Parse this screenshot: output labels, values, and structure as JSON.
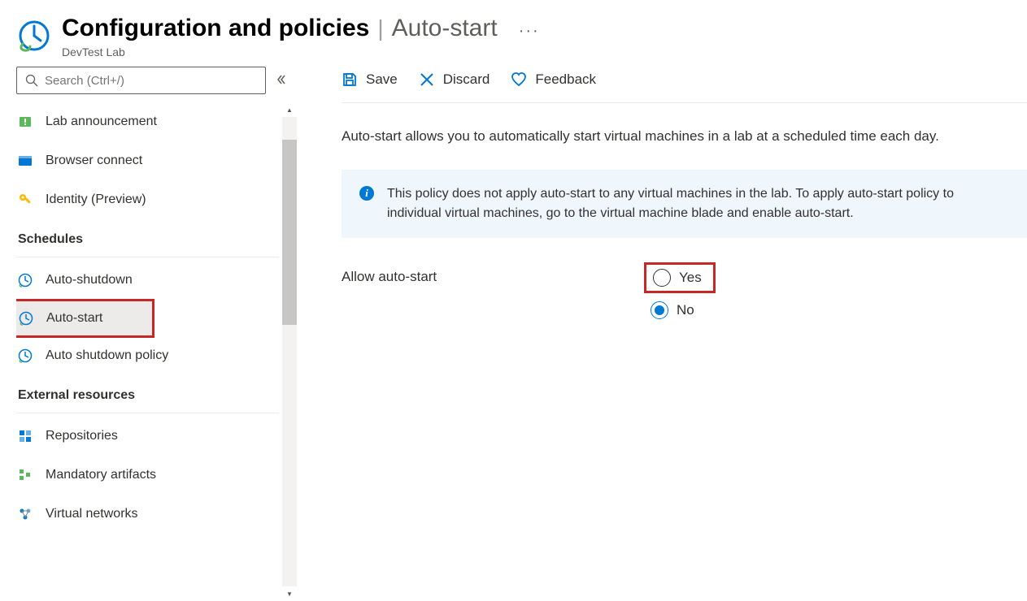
{
  "header": {
    "title": "Configuration and policies",
    "subtitle": "Auto-start",
    "type": "DevTest Lab"
  },
  "search": {
    "placeholder": "Search (Ctrl+/)"
  },
  "sidebar": {
    "items": [
      {
        "label": "Lab announcement"
      },
      {
        "label": "Browser connect"
      },
      {
        "label": "Identity (Preview)"
      }
    ],
    "schedules_header": "Schedules",
    "schedule_items": [
      {
        "label": "Auto-shutdown"
      },
      {
        "label": "Auto-start"
      },
      {
        "label": "Auto shutdown policy"
      }
    ],
    "external_header": "External resources",
    "external_items": [
      {
        "label": "Repositories"
      },
      {
        "label": "Mandatory artifacts"
      },
      {
        "label": "Virtual networks"
      }
    ]
  },
  "toolbar": {
    "save_label": "Save",
    "discard_label": "Discard",
    "feedback_label": "Feedback"
  },
  "main": {
    "description": "Auto-start allows you to automatically start virtual machines in a lab at a scheduled time each day.",
    "info": "This policy does not apply auto-start to any virtual machines in the lab. To apply auto-start policy to individual virtual machines, go to the virtual machine blade and enable auto-start.",
    "allow_label": "Allow auto-start",
    "yes_label": "Yes",
    "no_label": "No"
  }
}
